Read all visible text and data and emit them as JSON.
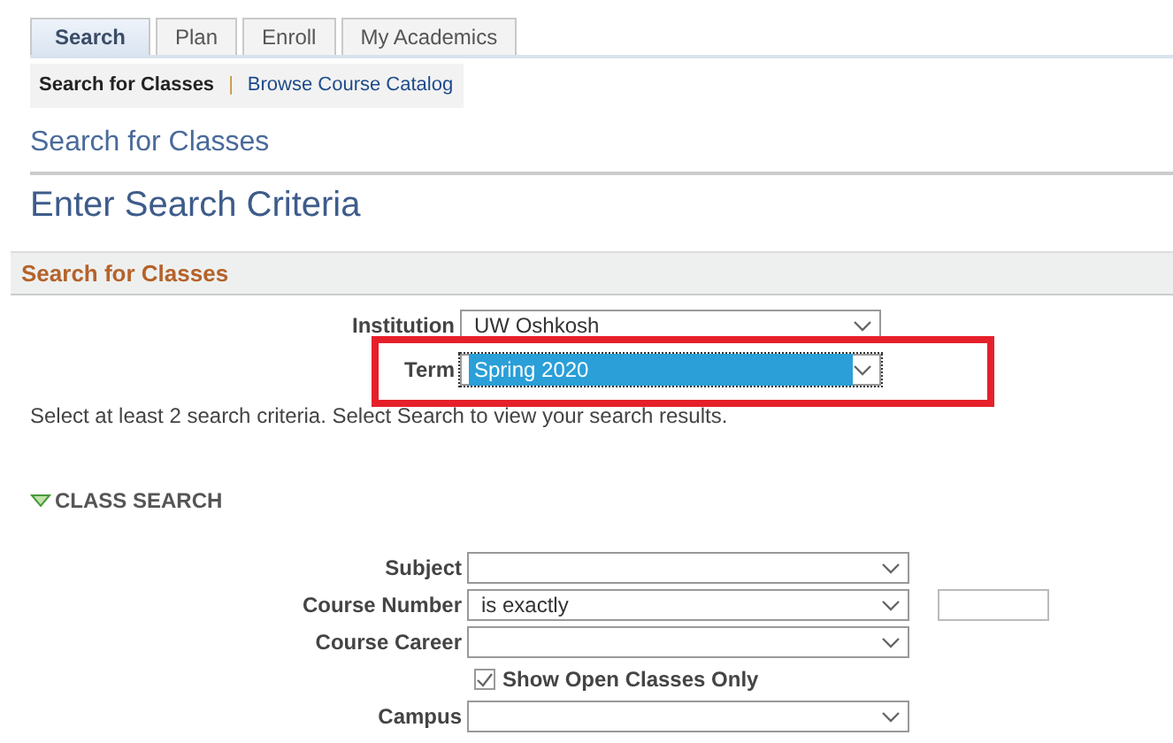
{
  "tabs": [
    {
      "label": "Search",
      "selected": true
    },
    {
      "label": "Plan",
      "selected": false
    },
    {
      "label": "Enroll",
      "selected": false
    },
    {
      "label": "My Academics",
      "selected": false
    }
  ],
  "subnav": {
    "separator": "|",
    "items": [
      {
        "label": "Search for Classes",
        "selected": true
      },
      {
        "label": "Browse Course Catalog",
        "selected": false
      }
    ]
  },
  "page_title": "Search for Classes",
  "heading": "Enter Search Criteria",
  "section_title": "Search for Classes",
  "criteria": [
    {
      "label": "Institution",
      "value": "UW Oshkosh",
      "focused": false,
      "highlighted": false
    },
    {
      "label": "Term",
      "value": "Spring 2020",
      "focused": true,
      "highlighted": true
    }
  ],
  "instruction": "Select at least 2 search criteria. Select Search to view your search results.",
  "class_search": {
    "title": "CLASS SEARCH",
    "expanded": true,
    "fields": [
      {
        "kind": "select",
        "label": "Subject"
      },
      {
        "kind": "select_input",
        "label": "Course Number",
        "value": "is exactly"
      },
      {
        "kind": "select",
        "label": "Course Career"
      },
      {
        "kind": "checkbox",
        "label": "Show Open Classes Only",
        "checked": true
      },
      {
        "kind": "select",
        "label": "Campus"
      }
    ]
  }
}
